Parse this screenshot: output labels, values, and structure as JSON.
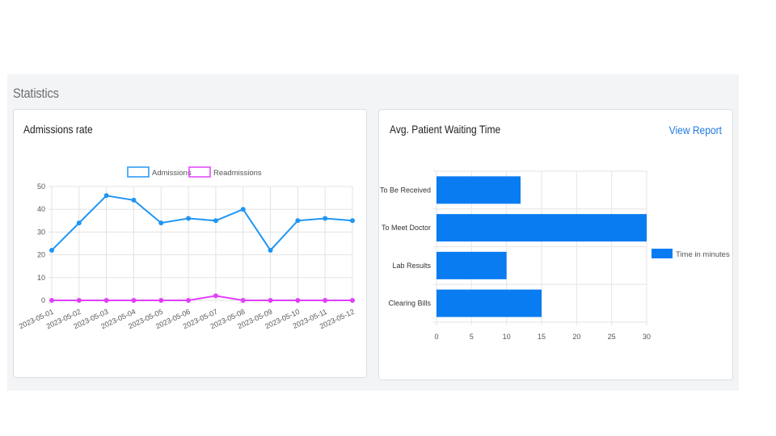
{
  "statistics": {
    "title": "Statistics"
  },
  "admissions_card": {
    "title": "Admissions rate"
  },
  "waiting_card": {
    "title": "Avg. Patient Waiting Time",
    "link_label": "View Report"
  },
  "colors": {
    "admissions": "#2196f3",
    "readmissions": "#e040fb",
    "bar": "#0a7cf2",
    "link": "#1f7ae0"
  },
  "chart_data": [
    {
      "type": "line",
      "title": "Admissions rate",
      "categories": [
        "2023-05-01",
        "2023-05-02",
        "2023-05-03",
        "2023-05-04",
        "2023-05-05",
        "2023-05-06",
        "2023-05-07",
        "2023-05-08",
        "2023-05-09",
        "2023-05-10",
        "2023-05-11",
        "2023-05-12"
      ],
      "series": [
        {
          "name": "Admissions",
          "values": [
            22,
            34,
            46,
            44,
            34,
            36,
            35,
            40,
            22,
            35,
            36,
            35
          ]
        },
        {
          "name": "Readmissions",
          "values": [
            0,
            0,
            0,
            0,
            0,
            0,
            2,
            0,
            0,
            0,
            0,
            0
          ]
        }
      ],
      "yticks": [
        "0",
        "10",
        "20",
        "30",
        "40",
        "50"
      ],
      "ylim": [
        0,
        50
      ],
      "grid": true,
      "legend": "top"
    },
    {
      "type": "bar",
      "orientation": "horizontal",
      "title": "Avg. Patient Waiting Time",
      "categories": [
        "To Be Received",
        "To Meet Doctor",
        "Lab Results",
        "Clearing Bills"
      ],
      "series": [
        {
          "name": "Time in minutes",
          "values": [
            12,
            30,
            10,
            15
          ]
        }
      ],
      "xticks": [
        "0",
        "5",
        "10",
        "15",
        "20",
        "25",
        "30"
      ],
      "xlim": [
        0,
        30
      ],
      "grid": true,
      "legend": "right"
    }
  ]
}
